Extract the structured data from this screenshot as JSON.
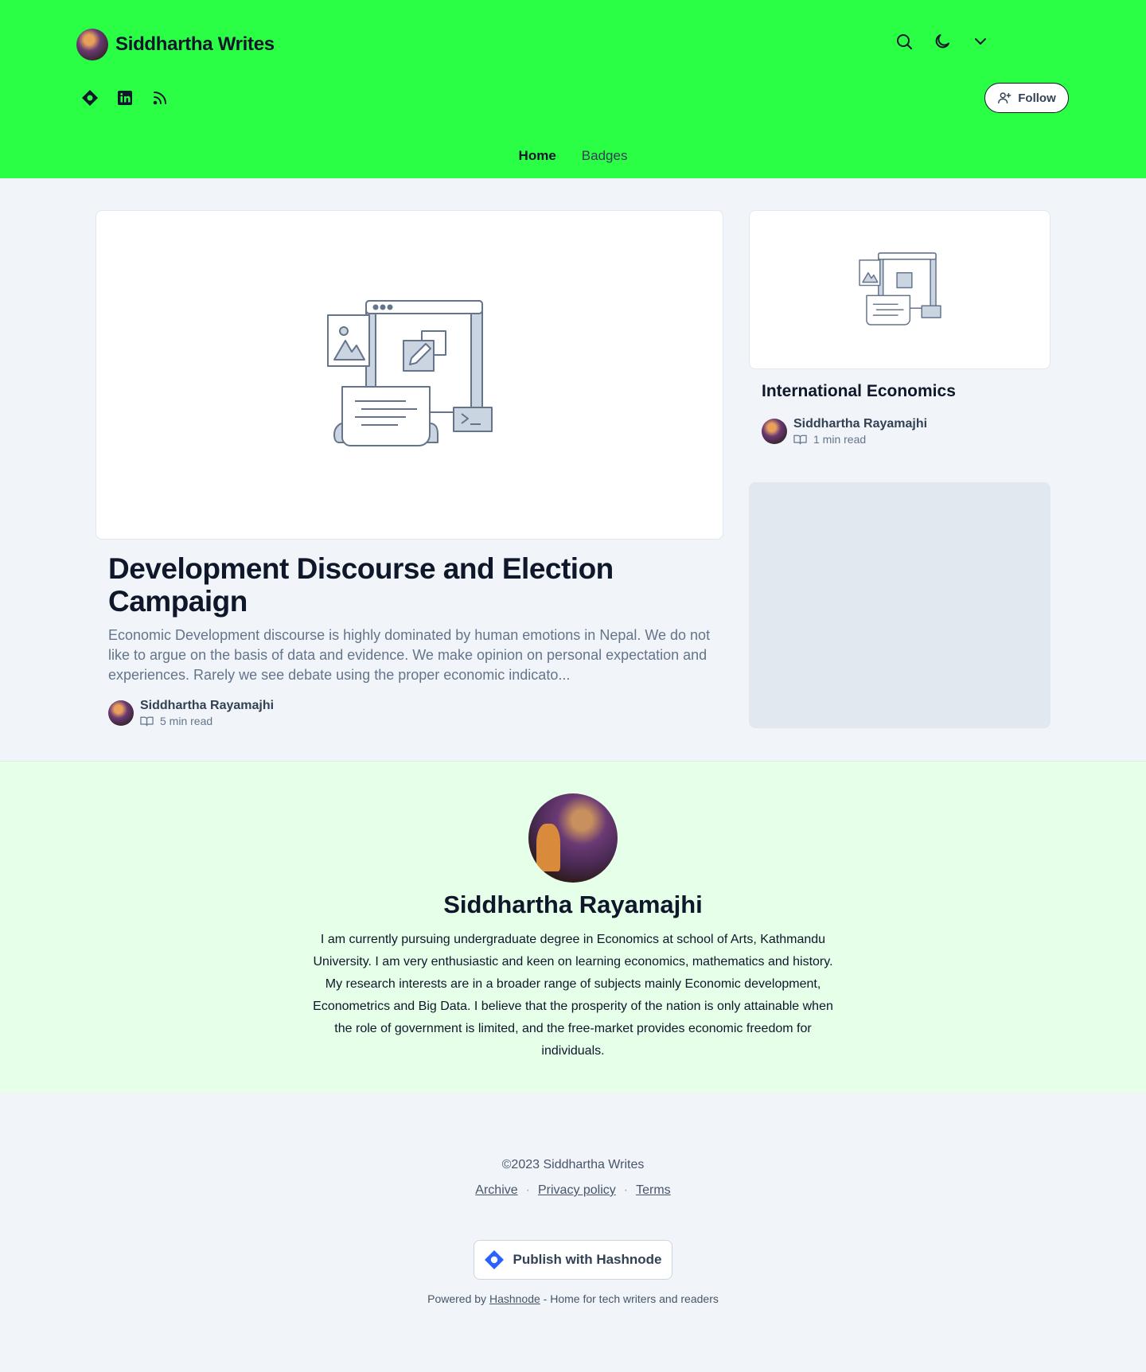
{
  "header": {
    "brand_title": "Siddhartha Writes",
    "follow_label": "Follow",
    "nav": [
      {
        "label": "Home"
      },
      {
        "label": "Badges"
      }
    ],
    "icons": [
      "search-icon",
      "moon-icon",
      "chevron-down-icon"
    ],
    "socials": [
      "hashnode-icon",
      "linkedin-icon",
      "rss-icon"
    ]
  },
  "featured_post": {
    "title": "Development Discourse and Election Campaign",
    "excerpt": "Economic Development discourse is highly dominated by human emotions in Nepal. We do not like to argue on the basis of data and evidence. We make opinion on personal expectation and experiences. Rarely we see debate using the proper economic indicato...",
    "author": "Siddhartha Rayamajhi",
    "read_time": "5 min read"
  },
  "side_post": {
    "title": "International Economics",
    "author": "Siddhartha Rayamajhi",
    "read_time": "1 min read"
  },
  "author_section": {
    "name": "Siddhartha Rayamajhi",
    "bio": "I am currently pursuing undergraduate degree in Economics at school of Arts, Kathmandu University. I am very enthusiastic and keen on learning economics, mathematics and history. My research interests are in a broader range of subjects mainly Economic development, Econometrics and Big Data. I believe that the prosperity of the nation is only attainable when the role of government is limited, and the free-market provides economic freedom for individuals."
  },
  "footer": {
    "copyright": "©2023 Siddhartha Writes",
    "links": [
      {
        "label": "Archive"
      },
      {
        "label": "Privacy policy"
      },
      {
        "label": "Terms"
      }
    ],
    "publish_label": "Publish with Hashnode",
    "powered_prefix": "Powered by",
    "powered_link": "Hashnode",
    "powered_suffix": "- Home for tech writers and readers"
  },
  "colors": {
    "header_bg": "#2bff45",
    "author_bg": "#e6ffe9",
    "hashnode_blue": "#2962ff"
  }
}
